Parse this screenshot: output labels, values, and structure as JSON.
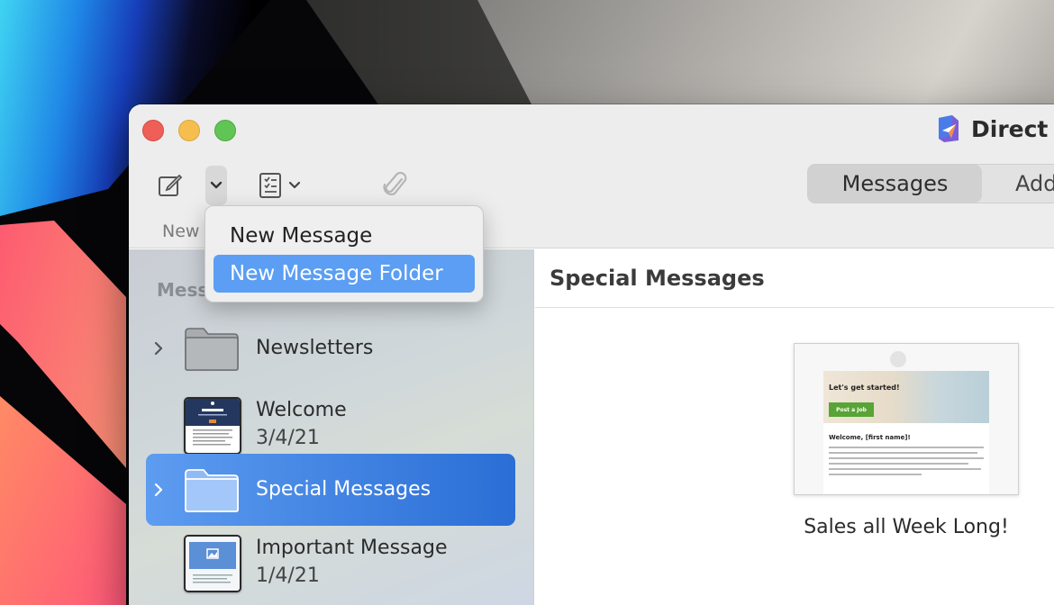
{
  "app": {
    "name": "Direct N"
  },
  "toolbar": {
    "new_label": "New",
    "icons": [
      "compose-icon",
      "chevron-down-icon",
      "template-icon",
      "paperclip-icon"
    ]
  },
  "segmented": {
    "active": "Messages",
    "next": "Add"
  },
  "menu": {
    "items": [
      {
        "label": "New Message"
      },
      {
        "label": "New Message Folder",
        "highlighted": true
      }
    ]
  },
  "sidebar": {
    "heading": "Mess",
    "items": [
      {
        "kind": "folder",
        "title": "Newsletters"
      },
      {
        "kind": "message",
        "title": "Welcome",
        "date": "3/4/21"
      },
      {
        "kind": "folder",
        "title": "Special Messages",
        "selected": true
      },
      {
        "kind": "message",
        "title": "Important Message",
        "date": "1/4/21"
      }
    ]
  },
  "main": {
    "title": "Special Messages",
    "card": {
      "hero_title": "Let's get started!",
      "cta": "Post a Job",
      "welcome": "Welcome, [first name]!",
      "caption": "Sales all Week Long!"
    }
  },
  "colors": {
    "accent": "#2a6ed6",
    "menu_highlight": "#5b9ef3",
    "cta_green": "#58a436"
  }
}
